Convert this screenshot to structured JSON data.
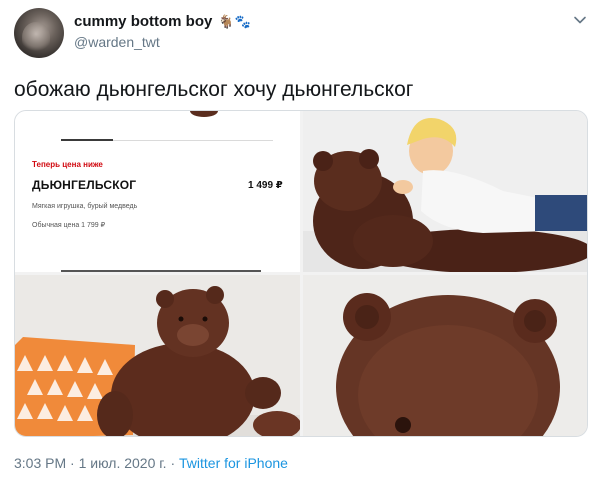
{
  "author": {
    "display_name": "cummy bottom boy",
    "emoji": "🐐🐾",
    "handle": "@warden_twt"
  },
  "tweet": {
    "text": "обожаю дьюнгельског хочу дьюнгельског"
  },
  "product_card": {
    "price_label": "Теперь цена ниже",
    "name": "ДЬЮНГЕЛЬСКОГ",
    "price": "1 499 ₽",
    "description": "Мягкая игрушка, бурый медведь",
    "old_price": "Обычная цена 1 799 ₽"
  },
  "footer": {
    "time": "3:03 PM",
    "separator": "·",
    "date": "1 июл. 2020 г.",
    "source": "Twitter for iPhone"
  },
  "colors": {
    "accent": "#1b95e0",
    "secondary_text": "#657786",
    "sale_red": "#d10a11",
    "bear_brown": "#5a2d1e"
  },
  "icons": {
    "menu": "chevron-down-icon"
  }
}
